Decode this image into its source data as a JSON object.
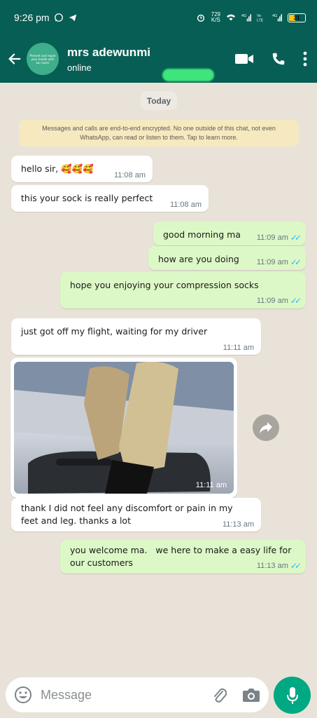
{
  "status_bar": {
    "time": "9:26 pm",
    "net_speed_value": "729",
    "net_speed_unit": "K/S",
    "battery": "31",
    "accent": "#075e54"
  },
  "header": {
    "contact_name": "mrs adewunmi",
    "contact_status": "online",
    "avatar_text": "Prevent and repair your health with our socks"
  },
  "chat": {
    "date_label": "Today",
    "encryption_notice": "Messages and calls are end-to-end encrypted. No one outside of this chat, not even WhatsApp, can read or listen to them. Tap to learn more.",
    "messages": [
      {
        "direction": "in",
        "text": "hello sir, 🥰🥰🥰",
        "time": "11:08 am"
      },
      {
        "direction": "in",
        "text": "this your sock is really perfect",
        "time": "11:08 am"
      },
      {
        "direction": "out",
        "text": "good morning ma",
        "time": "11:09 am"
      },
      {
        "direction": "out",
        "text": "how are you doing",
        "time": "11:09 am"
      },
      {
        "direction": "out",
        "text": "hope you enjoying your compression socks",
        "time": "11:09 am"
      },
      {
        "direction": "in",
        "text": "just got off my flight, waiting for my driver",
        "time": "11:11 am"
      },
      {
        "direction": "in",
        "type": "image",
        "time": "11:11 am"
      },
      {
        "direction": "in",
        "text": "thank I did not feel any discomfort or pain in my feet and leg. thanks a lot",
        "time": "11:13 am"
      },
      {
        "direction": "out",
        "text": "you welcome ma.   we here to make a easy life for our customers",
        "time": "11:13 am"
      }
    ]
  },
  "composer": {
    "placeholder": "Message"
  },
  "colors": {
    "header": "#075e54",
    "outgoing_bubble": "#dcf8c6",
    "incoming_bubble": "#ffffff",
    "mic_button": "#00a884",
    "read_ticks": "#34b7f1"
  }
}
